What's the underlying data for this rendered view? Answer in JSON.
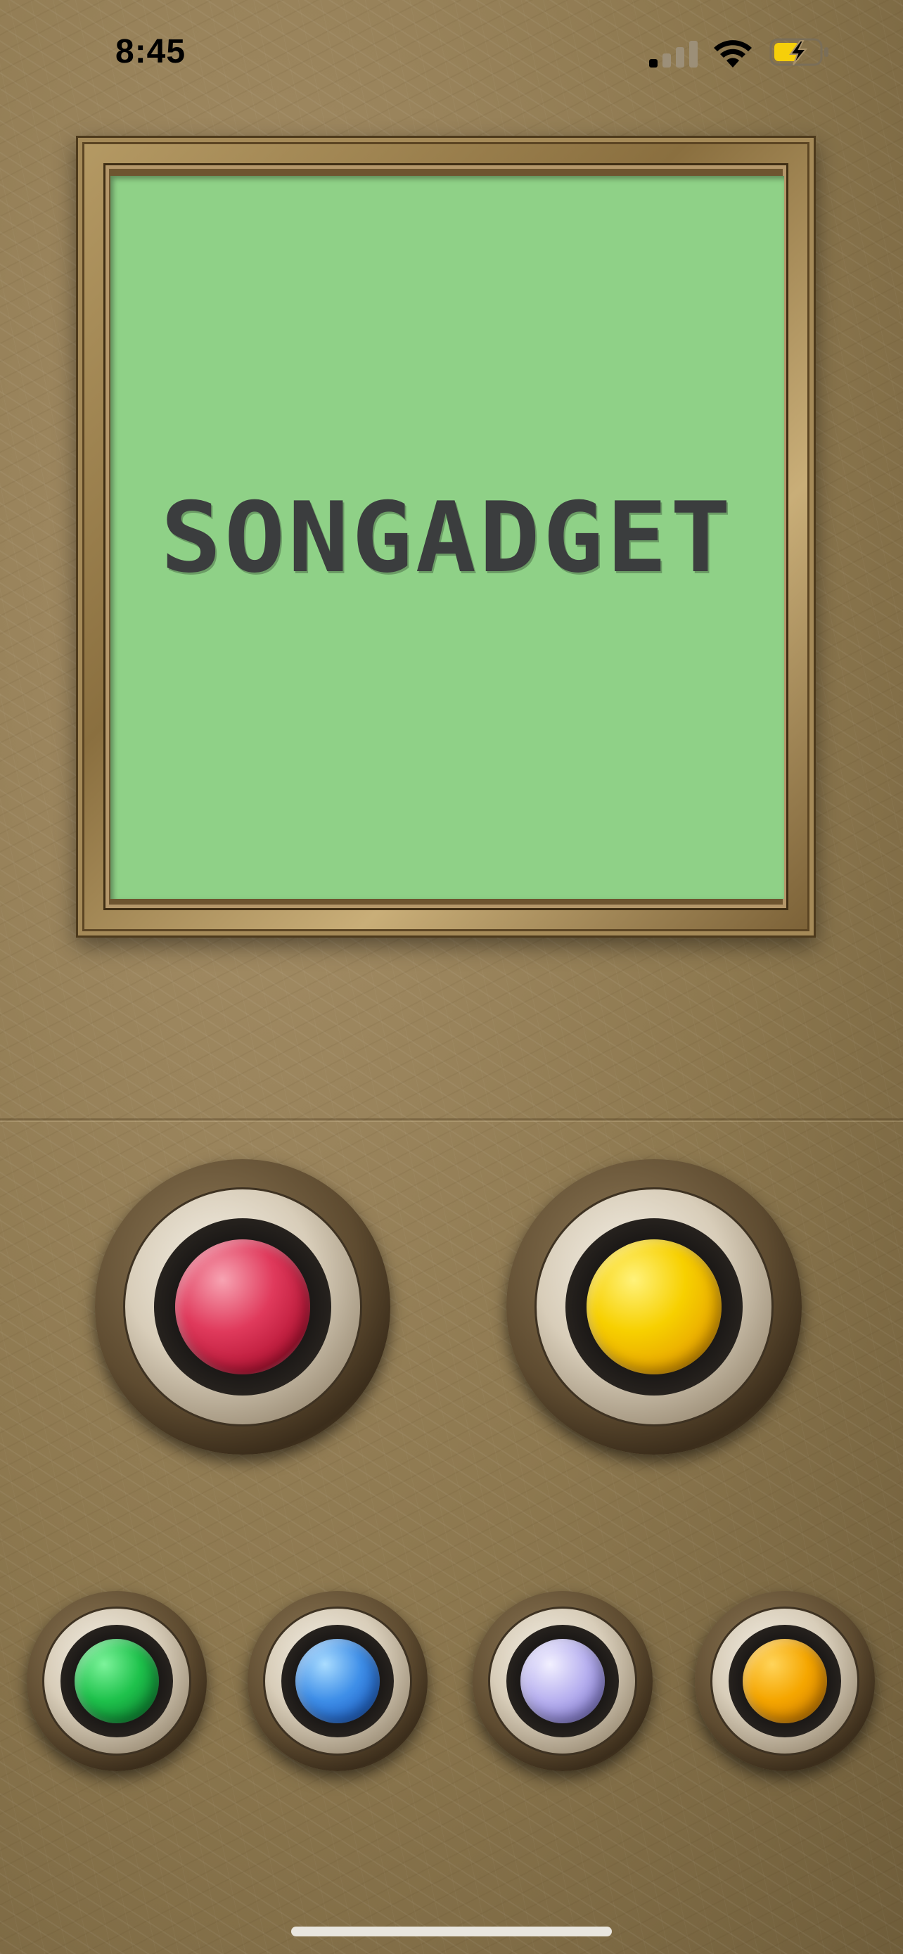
{
  "status_bar": {
    "time": "8:45",
    "icons": [
      "cellular-signal-icon",
      "wifi-icon",
      "battery-charging-icon"
    ]
  },
  "screen": {
    "logo_text": "SONGADGET",
    "lcd_color": "#8fd187",
    "text_color": "#3b3d3e"
  },
  "buttons": {
    "large": [
      {
        "name": "red",
        "color": "#d9304f"
      },
      {
        "name": "yellow",
        "color": "#f2c200"
      }
    ],
    "small": [
      {
        "name": "green",
        "color": "#1fc24c"
      },
      {
        "name": "blue",
        "color": "#3f8fe8"
      },
      {
        "name": "lavender",
        "color": "#b9b2f0"
      },
      {
        "name": "orange",
        "color": "#f5a600"
      }
    ]
  }
}
